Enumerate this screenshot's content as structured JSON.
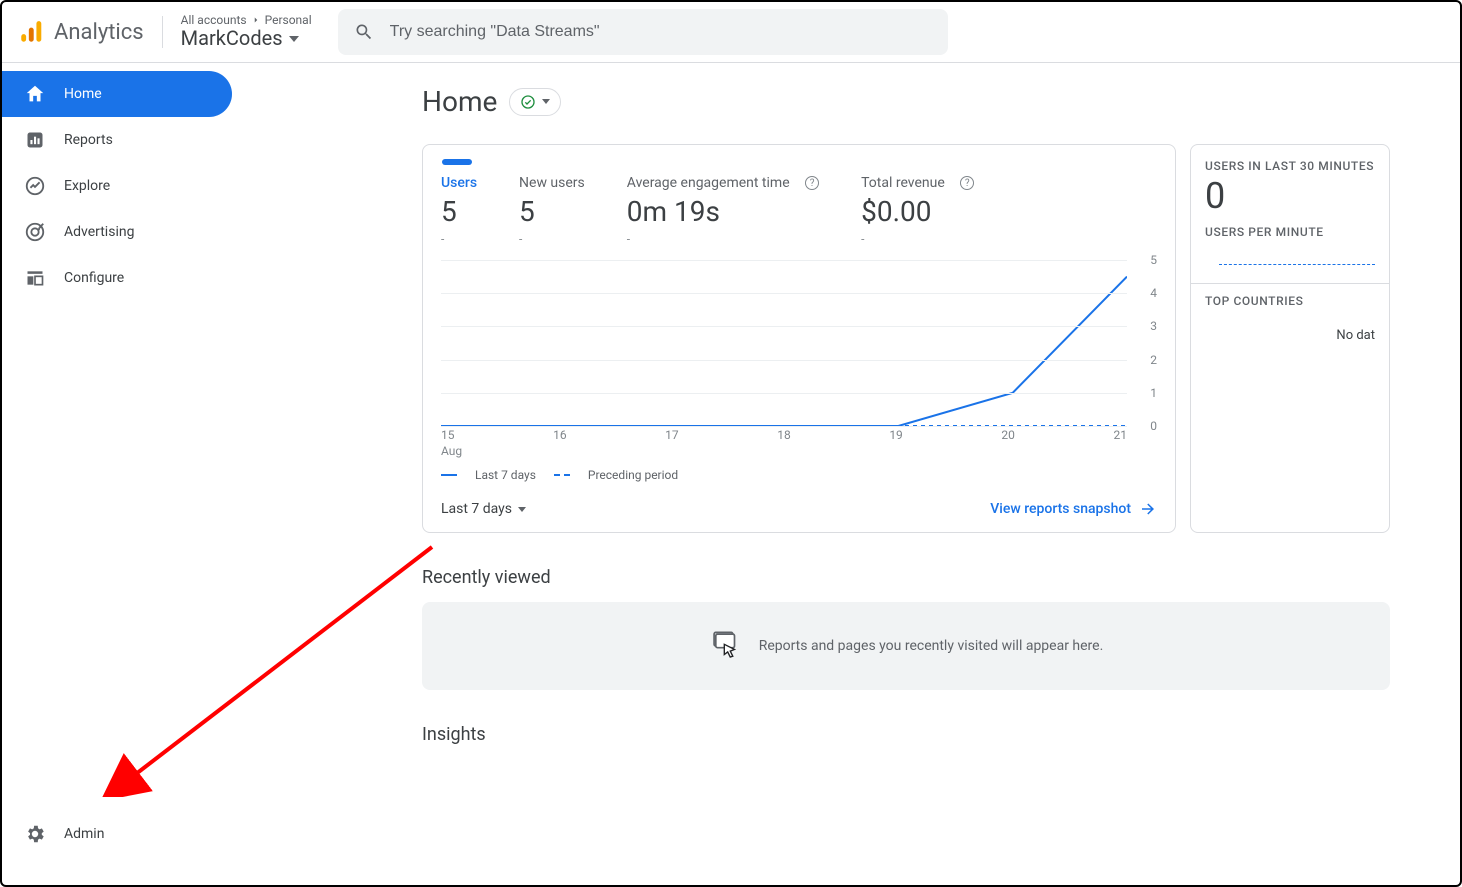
{
  "header": {
    "product": "Analytics",
    "breadcrumb_left": "All accounts",
    "breadcrumb_right": "Personal",
    "property": "MarkCodes",
    "search_placeholder": "Try searching \"Data Streams\""
  },
  "sidebar": {
    "items": [
      {
        "label": "Home",
        "icon": "home-icon",
        "active": true
      },
      {
        "label": "Reports",
        "icon": "bar-chart-icon",
        "active": false
      },
      {
        "label": "Explore",
        "icon": "trend-icon",
        "active": false
      },
      {
        "label": "Advertising",
        "icon": "target-icon",
        "active": false
      },
      {
        "label": "Configure",
        "icon": "grid-icon",
        "active": false
      }
    ],
    "admin_label": "Admin"
  },
  "page": {
    "title": "Home"
  },
  "overview_card": {
    "metrics": [
      {
        "label": "Users",
        "value": "5",
        "delta": "-",
        "active": true,
        "help": false
      },
      {
        "label": "New users",
        "value": "5",
        "delta": "-",
        "active": false,
        "help": false
      },
      {
        "label": "Average engagement time",
        "value": "0m 19s",
        "delta": "-",
        "active": false,
        "help": true
      },
      {
        "label": "Total revenue",
        "value": "$0.00",
        "delta": "-",
        "active": false,
        "help": true
      }
    ],
    "legend": {
      "current": "Last 7 days",
      "previous": "Preceding period"
    },
    "range_label": "Last 7 days",
    "snapshot_label": "View reports snapshot",
    "x_month": "Aug"
  },
  "chart_data": {
    "type": "line",
    "x": [
      "15",
      "16",
      "17",
      "18",
      "19",
      "20",
      "21"
    ],
    "ylim": [
      0,
      5
    ],
    "yticks": [
      0,
      1,
      2,
      3,
      4,
      5
    ],
    "series": [
      {
        "name": "Last 7 days",
        "values": [
          0,
          0,
          0,
          0,
          0,
          1,
          4.5
        ],
        "style": "solid"
      },
      {
        "name": "Preceding period",
        "values": [
          0,
          0,
          0,
          0,
          0,
          0,
          0
        ],
        "style": "dashed"
      }
    ],
    "xlabel": "Aug",
    "ylabel": "",
    "title": ""
  },
  "realtime_card": {
    "label_users": "USERS IN LAST 30 MINUTES",
    "users_value": "0",
    "label_per_min": "USERS PER MINUTE",
    "label_countries": "TOP COUNTRIES",
    "no_data": "No dat"
  },
  "recently_viewed": {
    "title": "Recently viewed",
    "empty_text": "Reports and pages you recently visited will appear here."
  },
  "insights": {
    "title": "Insights"
  }
}
